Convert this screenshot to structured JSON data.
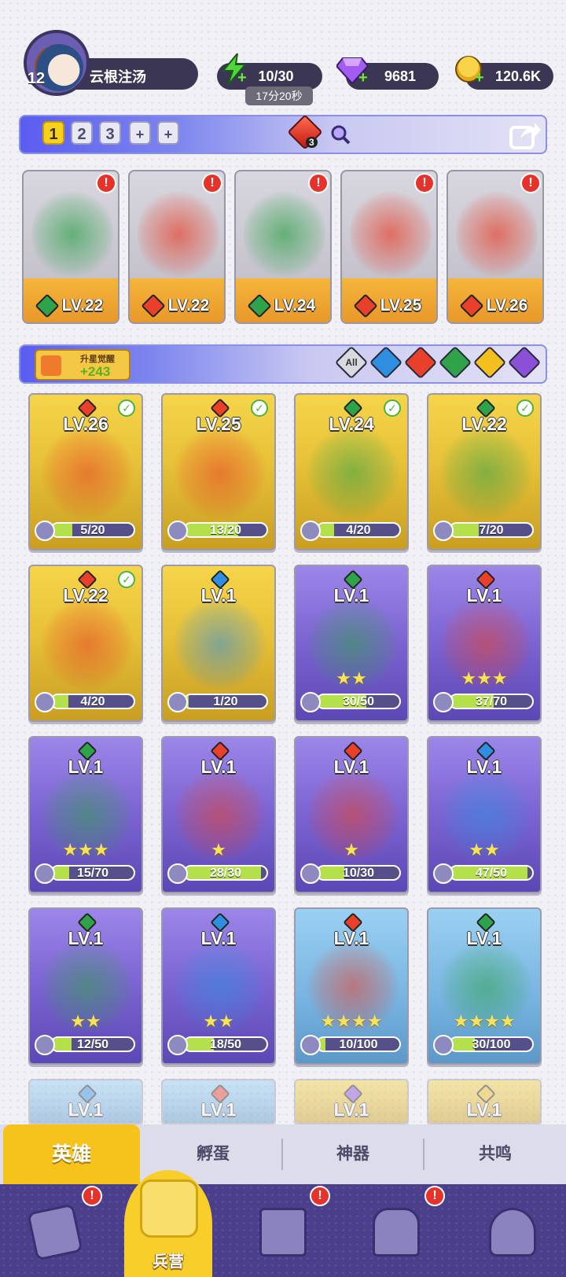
{
  "player": {
    "level": "12",
    "name": "云根注汤"
  },
  "resources": {
    "energy": {
      "value": "10/30",
      "icon": "lightning-icon",
      "timer": "17分20秒"
    },
    "gems": {
      "value": "9681",
      "icon": "diamond-icon"
    },
    "coins": {
      "value": "120.6K",
      "icon": "coin-icon"
    }
  },
  "team_tabs": [
    "1",
    "2",
    "3",
    "+",
    "+"
  ],
  "team_tab_active": 0,
  "fire_gem_count": "3",
  "colors": {
    "fire": "#e8402a",
    "water": "#2e8fe0",
    "earth": "#2fa34a",
    "light": "#f2c01e",
    "dark": "#8b4fd8",
    "accent": "#f5c31c"
  },
  "team": [
    {
      "level": "LV.22",
      "element": "earth"
    },
    {
      "level": "LV.22",
      "element": "fire"
    },
    {
      "level": "LV.24",
      "element": "earth"
    },
    {
      "level": "LV.25",
      "element": "fire"
    },
    {
      "level": "LV.26",
      "element": "fire"
    }
  ],
  "awaken": {
    "title": "升星觉醒",
    "value": "+243"
  },
  "filters": [
    "All",
    "water",
    "fire",
    "earth",
    "light",
    "dark"
  ],
  "filter_all_label": "All",
  "heroes": [
    {
      "level": "LV.26",
      "element": "fire",
      "shards": "5/20",
      "progress": 0.25,
      "rarity": "gold",
      "ready": true,
      "stars": ""
    },
    {
      "level": "LV.25",
      "element": "fire",
      "shards": "13/20",
      "progress": 0.65,
      "rarity": "gold",
      "ready": true,
      "stars": ""
    },
    {
      "level": "LV.24",
      "element": "earth",
      "shards": "4/20",
      "progress": 0.2,
      "rarity": "gold",
      "ready": true,
      "stars": ""
    },
    {
      "level": "LV.22",
      "element": "earth",
      "shards": "7/20",
      "progress": 0.35,
      "rarity": "gold",
      "ready": true,
      "stars": ""
    },
    {
      "level": "LV.22",
      "element": "fire",
      "shards": "4/20",
      "progress": 0.2,
      "rarity": "gold",
      "ready": true,
      "stars": ""
    },
    {
      "level": "LV.1",
      "element": "water",
      "shards": "1/20",
      "progress": 0.05,
      "rarity": "gold",
      "ready": false,
      "stars": ""
    },
    {
      "level": "LV.1",
      "element": "earth",
      "shards": "30/50",
      "progress": 0.6,
      "rarity": "purple",
      "ready": false,
      "stars": "★★"
    },
    {
      "level": "LV.1",
      "element": "fire",
      "shards": "37/70",
      "progress": 0.53,
      "rarity": "purple",
      "ready": false,
      "stars": "★★★"
    },
    {
      "level": "LV.1",
      "element": "earth",
      "shards": "15/70",
      "progress": 0.21,
      "rarity": "purple",
      "ready": false,
      "stars": "★★★"
    },
    {
      "level": "LV.1",
      "element": "fire",
      "shards": "28/30",
      "progress": 0.93,
      "rarity": "purple",
      "ready": false,
      "stars": "★"
    },
    {
      "level": "LV.1",
      "element": "fire",
      "shards": "10/30",
      "progress": 0.33,
      "rarity": "purple",
      "ready": false,
      "stars": "★"
    },
    {
      "level": "LV.1",
      "element": "water",
      "shards": "47/50",
      "progress": 0.94,
      "rarity": "purple",
      "ready": false,
      "stars": "★★"
    },
    {
      "level": "LV.1",
      "element": "earth",
      "shards": "12/50",
      "progress": 0.24,
      "rarity": "purple",
      "ready": false,
      "stars": "★★"
    },
    {
      "level": "LV.1",
      "element": "water",
      "shards": "18/50",
      "progress": 0.36,
      "rarity": "purple",
      "ready": false,
      "stars": "★★"
    },
    {
      "level": "LV.1",
      "element": "fire",
      "shards": "10/100",
      "progress": 0.1,
      "rarity": "blue",
      "ready": false,
      "stars": "★★★★"
    },
    {
      "level": "LV.1",
      "element": "earth",
      "shards": "30/100",
      "progress": 0.3,
      "rarity": "blue",
      "ready": false,
      "stars": "★★★★"
    }
  ],
  "partial_row": [
    {
      "level": "LV.1",
      "element": "water",
      "rarity": "blue"
    },
    {
      "level": "LV.1",
      "element": "fire",
      "rarity": "blue"
    },
    {
      "level": "LV.1",
      "element": "dark",
      "rarity": "gold"
    },
    {
      "level": "LV.1",
      "element": "light",
      "rarity": "gold"
    }
  ],
  "bottom_tabs": [
    "英雄",
    "孵蛋",
    "神器",
    "共鸣"
  ],
  "nav": {
    "active_label": "兵营",
    "items": [
      "cards-icon",
      "barracks-icon",
      "map-icon",
      "castle-icon",
      "mushroom-icon"
    ]
  }
}
